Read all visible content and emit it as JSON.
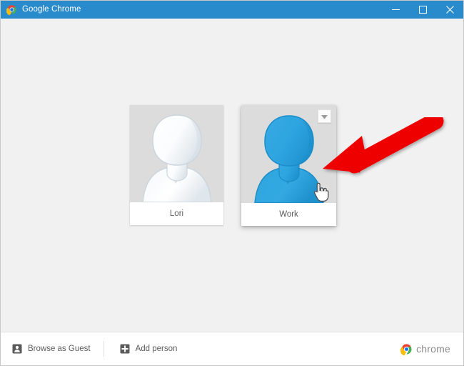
{
  "window": {
    "title": "Google Chrome",
    "app_icon": "chrome-logo-icon",
    "titlebar_color": "#2a8bcc",
    "controls": {
      "minimize": "minimize-icon",
      "maximize": "maximize-icon",
      "close": "close-icon"
    }
  },
  "main": {
    "background_color": "#f1f1f1",
    "profiles": [
      {
        "name": "Lori",
        "avatar": "generic-person-avatar",
        "avatar_color": "#f0f3f5",
        "avatar_background": "#dcdcdc",
        "selected": false,
        "hovered": false
      },
      {
        "name": "Work",
        "avatar": "generic-person-avatar",
        "avatar_color": "#29a3e0",
        "avatar_background": "#dcdcdc",
        "selected": false,
        "hovered": true,
        "dropdown_icon": "chevron-down-icon"
      }
    ]
  },
  "annotation": {
    "arrow_color": "#ee0000",
    "arrow_direction": "points-left-down-at-profile-dropdown",
    "cursor": "pointing-hand-cursor"
  },
  "bottom_bar": {
    "browse_as_guest": {
      "label": "Browse as Guest",
      "icon": "guest-person-icon"
    },
    "add_person": {
      "label": "Add person",
      "icon": "add-person-plus-icon"
    },
    "brand": {
      "text": "chrome",
      "icon": "chrome-logo-icon",
      "text_color": "#8c8c8c"
    }
  }
}
